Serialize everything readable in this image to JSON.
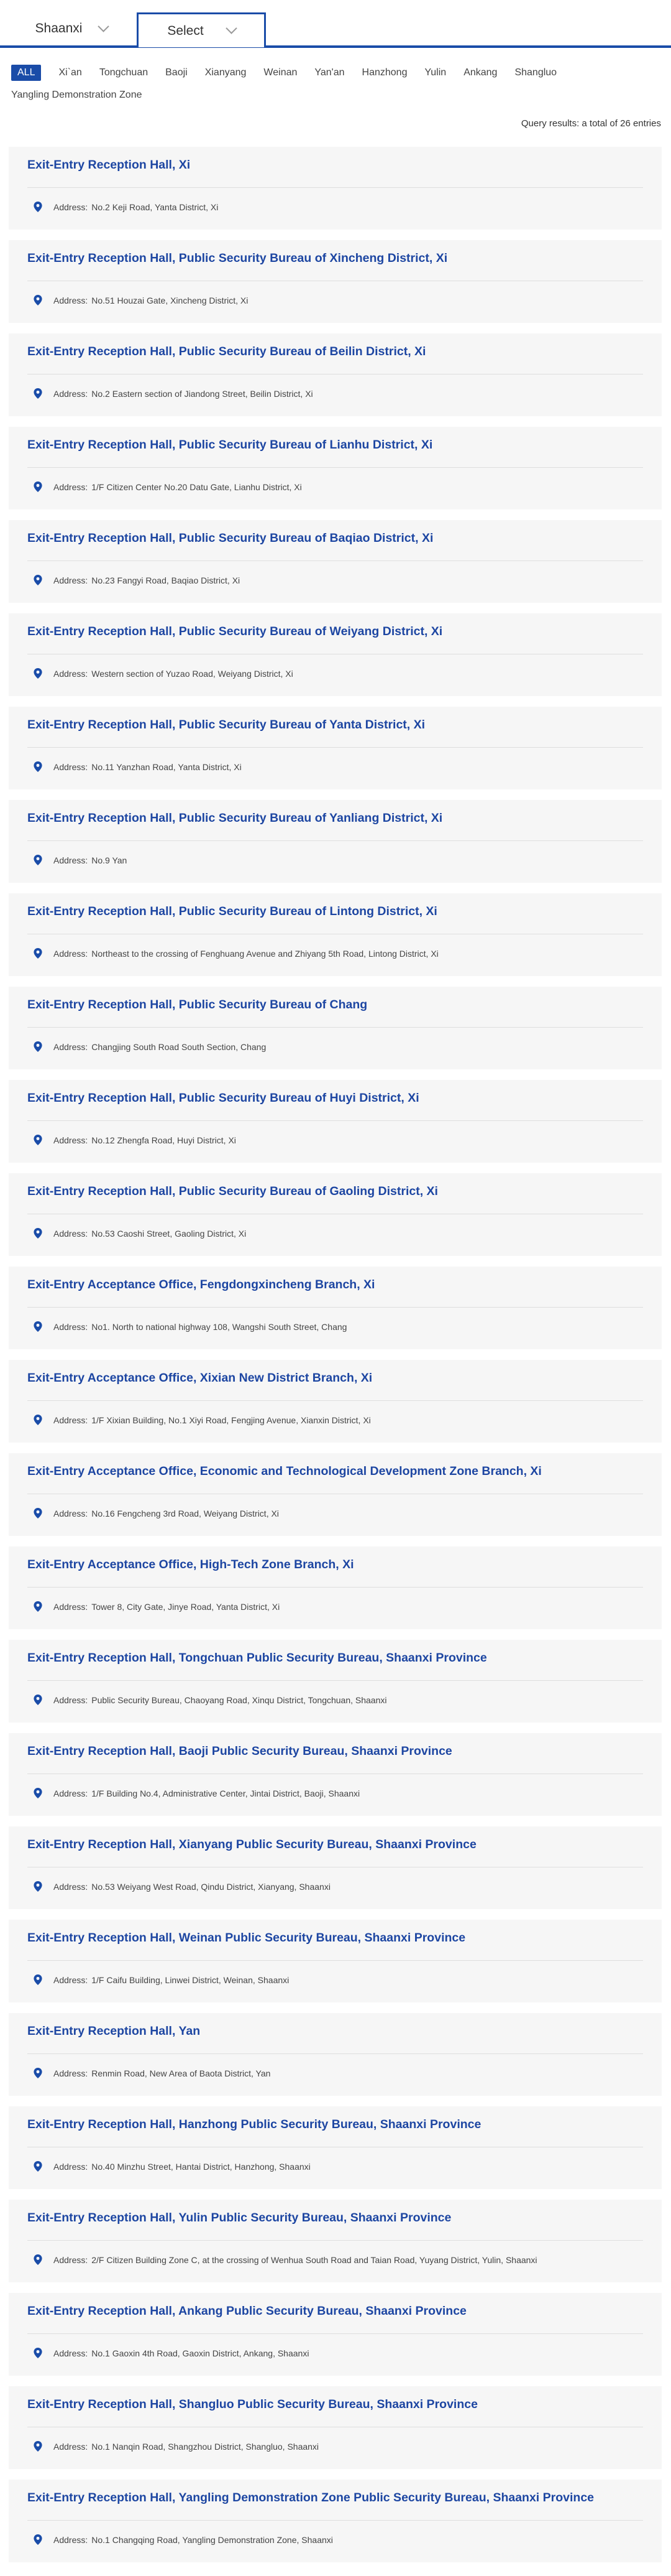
{
  "selector": {
    "province": "Shaanxi",
    "city_placeholder": "Select"
  },
  "filters": [
    {
      "label": "ALL",
      "active": true
    },
    {
      "label": "Xi`an",
      "active": false
    },
    {
      "label": "Tongchuan",
      "active": false
    },
    {
      "label": "Baoji",
      "active": false
    },
    {
      "label": "Xianyang",
      "active": false
    },
    {
      "label": "Weinan",
      "active": false
    },
    {
      "label": "Yan'an",
      "active": false
    },
    {
      "label": "Hanzhong",
      "active": false
    },
    {
      "label": "Yulin",
      "active": false
    },
    {
      "label": "Ankang",
      "active": false
    },
    {
      "label": "Shangluo",
      "active": false
    },
    {
      "label": "Yangling Demonstration Zone",
      "active": false
    }
  ],
  "query_result": "Query results: a total of 26 entries",
  "address_label": "Address:",
  "icons": {
    "address": "location-pin-icon"
  },
  "colors": {
    "accent": "#1a4ca8",
    "title": "#1d46a2",
    "card_bg": "#f6f6f6"
  },
  "entries": [
    {
      "title": "Exit-Entry Reception Hall, Xi",
      "address": "No.2 Keji Road, Yanta District, Xi"
    },
    {
      "title": "Exit-Entry Reception Hall, Public Security Bureau of Xincheng District, Xi",
      "address": "No.51 Houzai Gate, Xincheng District, Xi"
    },
    {
      "title": "Exit-Entry Reception Hall, Public Security Bureau of Beilin District, Xi",
      "address": "No.2 Eastern section of Jiandong Street, Beilin District, Xi"
    },
    {
      "title": "Exit-Entry Reception Hall, Public Security Bureau of Lianhu District, Xi",
      "address": "1/F Citizen Center No.20 Datu Gate, Lianhu District, Xi"
    },
    {
      "title": "Exit-Entry Reception Hall, Public Security Bureau of Baqiao District, Xi",
      "address": "No.23 Fangyi Road, Baqiao District, Xi"
    },
    {
      "title": "Exit-Entry Reception Hall, Public Security Bureau of Weiyang District, Xi",
      "address": "Western section of Yuzao Road, Weiyang District, Xi"
    },
    {
      "title": "Exit-Entry Reception Hall, Public Security Bureau of Yanta District, Xi",
      "address": "No.11 Yanzhan Road, Yanta District, Xi"
    },
    {
      "title": "Exit-Entry Reception Hall, Public Security Bureau of Yanliang District, Xi",
      "address": "No.9 Yan"
    },
    {
      "title": "Exit-Entry Reception Hall, Public Security Bureau of Lintong District, Xi",
      "address": "Northeast to the crossing of Fenghuang Avenue and Zhiyang 5th Road, Lintong District, Xi"
    },
    {
      "title": "Exit-Entry Reception Hall, Public Security Bureau of Chang",
      "address": "Changjing South Road South Section, Chang"
    },
    {
      "title": "Exit-Entry Reception Hall, Public Security Bureau of Huyi District, Xi",
      "address": "No.12 Zhengfa Road, Huyi District, Xi"
    },
    {
      "title": "Exit-Entry Reception Hall, Public Security Bureau of Gaoling District, Xi",
      "address": "No.53 Caoshi Street, Gaoling District, Xi"
    },
    {
      "title": "Exit-Entry Acceptance Office, Fengdongxincheng Branch, Xi",
      "address": "No1. North to national highway 108, Wangshi South Street, Chang"
    },
    {
      "title": "Exit-Entry Acceptance Office, Xixian New District Branch, Xi",
      "address": "1/F Xixian Building, No.1 Xiyi Road, Fengjing Avenue, Xianxin District, Xi"
    },
    {
      "title": "Exit-Entry Acceptance Office, Economic and Technological Development Zone Branch, Xi",
      "address": "No.16 Fengcheng 3rd Road, Weiyang District, Xi"
    },
    {
      "title": "Exit-Entry Acceptance Office, High-Tech Zone Branch, Xi",
      "address": "Tower 8, City Gate, Jinye Road, Yanta District, Xi"
    },
    {
      "title": "Exit-Entry Reception Hall, Tongchuan Public Security Bureau, Shaanxi Province",
      "address": "Public Security Bureau, Chaoyang Road, Xinqu District, Tongchuan, Shaanxi"
    },
    {
      "title": "Exit-Entry Reception Hall, Baoji Public Security Bureau, Shaanxi Province",
      "address": "1/F Building No.4, Administrative Center, Jintai District, Baoji, Shaanxi"
    },
    {
      "title": "Exit-Entry Reception Hall, Xianyang Public Security Bureau, Shaanxi Province",
      "address": "No.53 Weiyang West Road, Qindu District, Xianyang, Shaanxi"
    },
    {
      "title": "Exit-Entry Reception Hall, Weinan Public Security Bureau, Shaanxi Province",
      "address": "1/F Caifu Building, Linwei District, Weinan, Shaanxi"
    },
    {
      "title": "Exit-Entry Reception Hall, Yan",
      "address": "Renmin Road, New Area of Baota District, Yan"
    },
    {
      "title": "Exit-Entry Reception Hall, Hanzhong Public Security Bureau, Shaanxi Province",
      "address": "No.40 Minzhu Street, Hantai District, Hanzhong, Shaanxi"
    },
    {
      "title": "Exit-Entry Reception Hall, Yulin Public Security Bureau, Shaanxi Province",
      "address": "2/F Citizen Building Zone C, at the crossing of Wenhua South Road and Taian Road, Yuyang District, Yulin, Shaanxi"
    },
    {
      "title": "Exit-Entry Reception Hall, Ankang Public Security Bureau, Shaanxi Province",
      "address": "No.1 Gaoxin 4th Road, Gaoxin District, Ankang, Shaanxi"
    },
    {
      "title": "Exit-Entry Reception Hall, Shangluo Public Security Bureau, Shaanxi Province",
      "address": "No.1 Nanqin Road, Shangzhou District, Shangluo, Shaanxi"
    },
    {
      "title": "Exit-Entry Reception Hall, Yangling Demonstration Zone Public Security Bureau, Shaanxi Province",
      "address": "No.1 Changqing Road, Yangling Demonstration Zone, Shaanxi"
    }
  ]
}
